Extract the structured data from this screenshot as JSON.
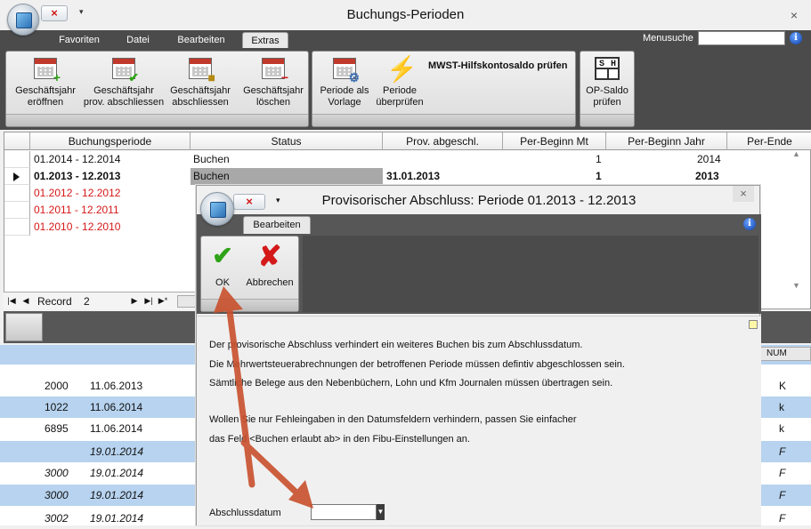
{
  "main": {
    "title": "Buchungs-Perioden",
    "close_glyph": "×",
    "qa_menu_glyph": "▾",
    "tabs": [
      "Favoriten",
      "Datei",
      "Bearbeiten",
      "Extras"
    ],
    "active_tab": "Extras",
    "menusuche_label": "Menusuche",
    "menusuche_value": "",
    "info_glyph": "i"
  },
  "ribbon": {
    "group1": [
      {
        "label_l1": "Geschäftsjahr",
        "label_l2": "eröffnen",
        "icon": "calendar-add-icon"
      },
      {
        "label_l1": "Geschäftsjahr",
        "label_l2": "prov. abschliessen",
        "icon": "calendar-check-icon"
      },
      {
        "label_l1": "Geschäftsjahr",
        "label_l2": "abschliessen",
        "icon": "calendar-lock-icon"
      },
      {
        "label_l1": "Geschäftsjahr",
        "label_l2": "löschen",
        "icon": "calendar-delete-icon"
      }
    ],
    "group2": {
      "buttons": [
        {
          "label_l1": "Periode als",
          "label_l2": "Vorlage",
          "icon": "calendar-gear-icon"
        },
        {
          "label_l1": "Periode",
          "label_l2": "überprüfen",
          "icon": "lightning-icon"
        }
      ],
      "mwst_label": "MWST-Hilfskontosaldo prüfen"
    },
    "group3": {
      "label_l1": "OP-Saldo",
      "label_l2": "prüfen",
      "icon_text_left": "S",
      "icon_text_right": "H"
    }
  },
  "grid": {
    "columns": [
      "Buchungsperiode",
      "Status",
      "Prov. abgeschl.",
      "Per-Beginn Mt",
      "Per-Beginn Jahr",
      "Per-Ende"
    ],
    "rows": [
      {
        "periode": "01.2014 - 12.2014",
        "status": "Buchen",
        "prov": "",
        "beginn_mt": "1",
        "beginn_jahr": "2014",
        "style": "normal"
      },
      {
        "periode": "01.2013 - 12.2013",
        "status": "Buchen",
        "prov": "31.01.2013",
        "beginn_mt": "1",
        "beginn_jahr": "2013",
        "style": "bold"
      },
      {
        "periode": "01.2012 - 12.2012",
        "status": "",
        "prov": "",
        "beginn_mt": "",
        "beginn_jahr": "",
        "style": "red"
      },
      {
        "periode": "01.2011 - 12.2011",
        "status": "",
        "prov": "",
        "beginn_mt": "",
        "beginn_jahr": "",
        "style": "red"
      },
      {
        "periode": "01.2010 - 12.2010",
        "status": "",
        "prov": "",
        "beginn_mt": "",
        "beginn_jahr": "",
        "style": "red"
      }
    ],
    "nav": {
      "record_label": "Record",
      "record_value": "2"
    }
  },
  "list2": {
    "status_num": "NUM",
    "rows": [
      {
        "num": "2000",
        "date": "11.06.2013",
        "flag": "K",
        "italic": false
      },
      {
        "num": "1022",
        "date": "11.06.2014",
        "flag": "k",
        "italic": false
      },
      {
        "num": "6895",
        "date": "11.06.2014",
        "flag": "k",
        "italic": false
      },
      {
        "num": "",
        "date": "19.01.2014",
        "flag": "F",
        "italic": true
      },
      {
        "num": "3000",
        "date": "19.01.2014",
        "flag": "F",
        "italic": true
      },
      {
        "num": "3000",
        "date": "19.01.2014",
        "flag": "F",
        "italic": true
      },
      {
        "num": "3002",
        "date": "19.01.2014",
        "flag": "F",
        "italic": true
      }
    ]
  },
  "dialog": {
    "title": "Provisorischer Abschluss: Periode 01.2013 - 12.2013",
    "close_glyph": "×",
    "tab": "Bearbeiten",
    "ok_label": "OK",
    "cancel_label": "Abbrechen",
    "text_lines": [
      "Der provisorische Abschluss verhindert ein weiteres Buchen bis zum Abschlussdatum.",
      "Die Mehrwertsteuerabrechnungen der betroffenen Periode müssen defintiv abgeschlossen sein.",
      "Sämtliche Belege aus den Nebenbüchern, Lohn und Kfm Journalen müssen übertragen sein.",
      "Wollen Sie nur Fehleingaben in den Datumsfeldern verhindern, passen Sie einfacher",
      "das Feld <Buchen erlaubt ab> in den Fibu-Einstellungen an."
    ],
    "abschlussdatum_label": "Abschlussdatum",
    "abschlussdatum_value": ""
  },
  "colors": {
    "accent_red": "#d51717",
    "ribbon_dark": "#4b4b4b",
    "row_blue": "#b7d3ef",
    "arrow": "#c9502c"
  }
}
